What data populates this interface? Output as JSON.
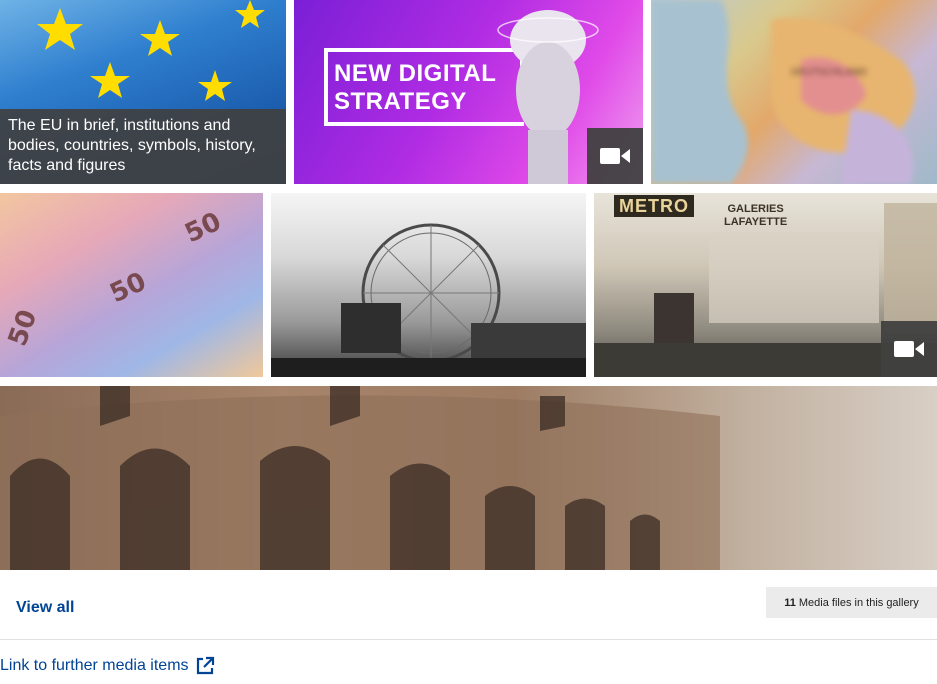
{
  "gallery": {
    "tiles": [
      {
        "id": "flag",
        "caption": "The EU in brief, institutions and bodies, countries, symbols, history, facts and figures",
        "video": false
      },
      {
        "id": "digital",
        "title_line1": "NEW DIGITAL",
        "title_line2": "STRATEGY",
        "video": true
      },
      {
        "id": "map",
        "video": false,
        "map_words": [
          "DEUTSCHLAND"
        ]
      },
      {
        "id": "euros",
        "banknote_values": [
          "50",
          "50",
          "50"
        ],
        "video": false
      },
      {
        "id": "london-eye",
        "video": false
      },
      {
        "id": "metro",
        "sign": "METRO",
        "store_line1": "GALERIES",
        "store_line2": "LAFAYETTE",
        "video": true
      },
      {
        "id": "colosseum",
        "video": false
      }
    ]
  },
  "footer": {
    "view_all": "View all",
    "media_count_number": "11",
    "media_count_text": "Media files in this gallery",
    "further_link": "Link to further media items"
  },
  "colors": {
    "link": "#004494",
    "caption_bg": "#404040",
    "badge_bg": "#ebebeb"
  }
}
